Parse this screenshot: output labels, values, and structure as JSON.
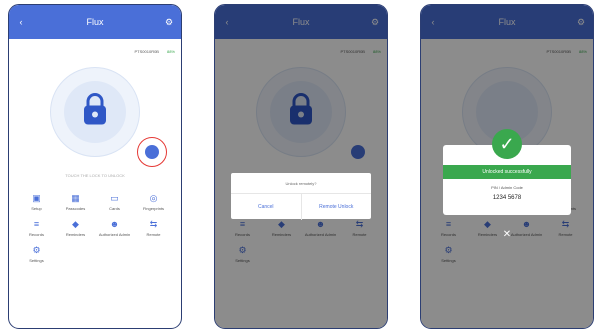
{
  "screens": [
    {
      "header": {
        "title": "Flux",
        "back_icon": "back-arrow-icon",
        "menu_icon": "settings-icon"
      },
      "status": {
        "serial": "PTS0010R0B",
        "battery": "88%"
      },
      "hint": "TOUCH THE LOCK TO UNLOCK",
      "grid": [
        {
          "label": "Setup",
          "icon": "lock-icon"
        },
        {
          "label": "Passcodes",
          "icon": "keypad-icon"
        },
        {
          "label": "Cards",
          "icon": "card-icon"
        },
        {
          "label": "Fingerprints",
          "icon": "fingerprint-icon"
        },
        {
          "label": "Records",
          "icon": "record-icon"
        },
        {
          "label": "Reminders",
          "icon": "bell-icon"
        },
        {
          "label": "Authorized Admin",
          "icon": "admin-icon"
        },
        {
          "label": "Remote",
          "icon": "remote-icon"
        },
        {
          "label": "Settings",
          "icon": "gear-icon"
        }
      ]
    },
    {
      "dialog": {
        "message": "Unlock remotely?",
        "cancel": "Cancel",
        "confirm": "Remote Unlock"
      }
    },
    {
      "success": {
        "banner": "Unlocked successfully",
        "sub": "PIN / Admin Code",
        "code": "1234 5678"
      }
    }
  ],
  "colors": {
    "accent": "#4a6fd8",
    "success": "#3aa84e",
    "highlight": "#e53935"
  }
}
